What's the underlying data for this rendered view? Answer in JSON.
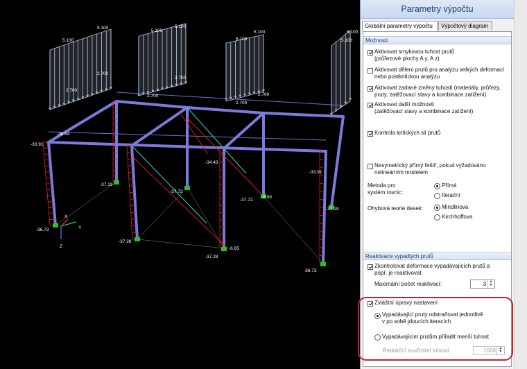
{
  "model": {
    "loads": [
      "5.100",
      "5.100",
      "5.100",
      "5.100",
      "5.100",
      "5.100",
      "5.100",
      "5.100",
      "2.700",
      "2.700",
      "2.700",
      "2.700",
      "2.700",
      "2.700"
    ],
    "values": [
      "-33.91",
      "-38.54",
      "-37.19",
      "-37.72",
      "-34.43",
      "-37.72",
      "-6.09",
      "-33.91",
      "-37.19",
      "-36.73",
      "-37.28",
      "-37.28",
      "-6.65",
      "-36.73"
    ],
    "axes": {
      "x": "X",
      "y": "Y",
      "z": "Z"
    }
  },
  "panel": {
    "title": "Parametry výpočtu",
    "tabs": [
      "Globální parametry výpočtu",
      "Výpočtový diagram"
    ],
    "section_options": "Možnosti",
    "opt_shear": "Aktivovat smykovou tuhost prutů",
    "opt_shear_sub": "(průřezové plochy A y, A z)",
    "opt_divide": "Aktivovat dělení prutů pro analýzu velkých deformací",
    "opt_divide_sub": "nebo postkritickou analýzu",
    "opt_stiff": "Aktivovat zadané změny tuhosti (materiály, průřezy,",
    "opt_stiff_sub": "pruty, zatěžovací stavy a kombinace zatížení)",
    "opt_more": "Aktivovat další možnosti",
    "opt_more_sub": "(zatěžovací stavy a kombinace zatížení)",
    "opt_critical": "Kontrola kritických sil prutů",
    "opt_nonsym": "Nesymetrický přímý řešič, pokud vyžadováno",
    "opt_nonsym_sub": "nelineárním modelem",
    "method_label": "Metoda pro",
    "method_label2": "systém rovnic:",
    "method_direct": "Přímá",
    "method_iter": "Iterační",
    "bending_label": "Ohybová teorie desek:",
    "bending_mindlin": "Mindlinova",
    "bending_kirch": "Kirchhoffova",
    "section_reactivation": "Reaktivace vypadlých prutů",
    "react_check": "Zkontrolovat deformace vypadávajících prutů a",
    "react_check_sub": "popř. je reaktivovat",
    "react_max_label": "Maximální počet reaktivací:",
    "react_max_value": "3",
    "special": "Zvláštní úpravy nastavení",
    "special_remove": "Vypadávající pruty odstraňovat jednotlivě",
    "special_remove_sub": "v po sobě jdoucích iteracích",
    "special_lower": "Vypadávajícím prutům přiřadit menší tuhost",
    "reduction_label": "Redukční součinitel tuhosti:",
    "reduction_value": "1000"
  }
}
